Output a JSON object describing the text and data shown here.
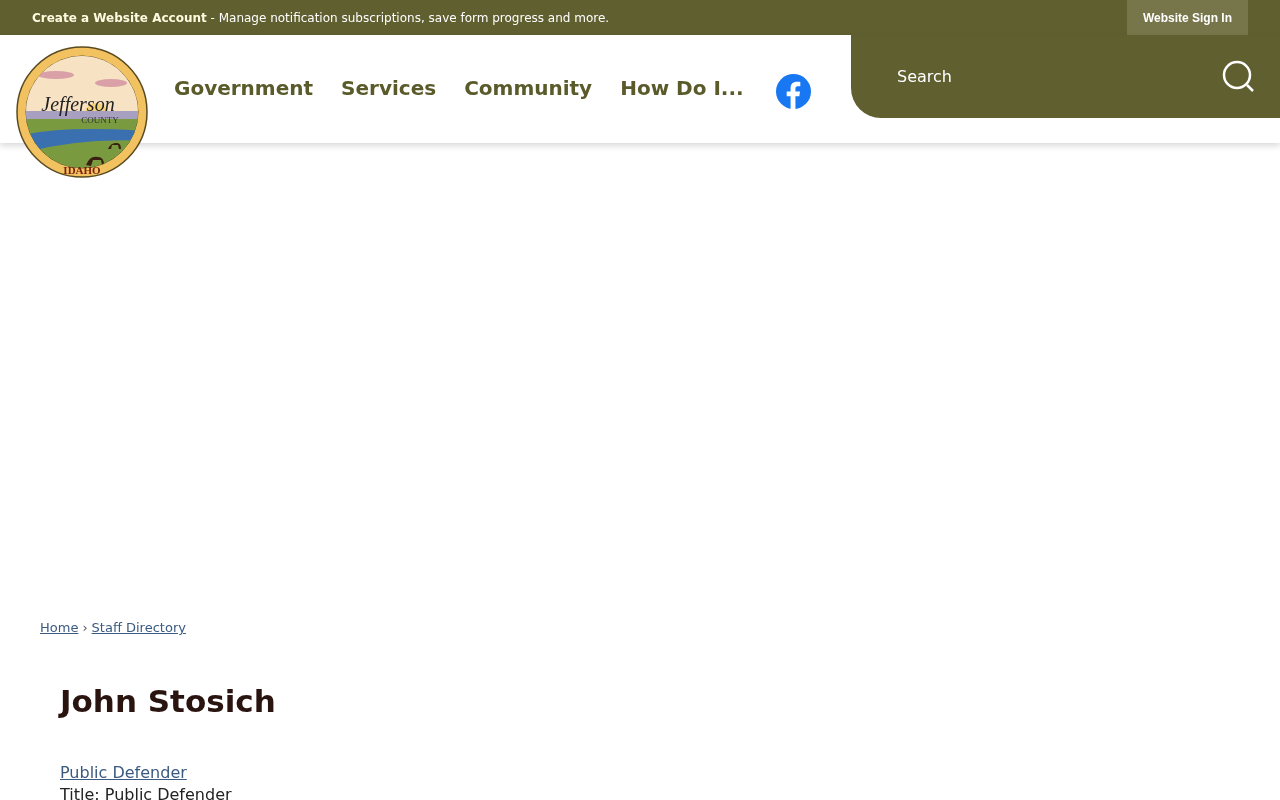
{
  "top_bar": {
    "account_link": "Create a Website Account",
    "account_text": " - Manage notification subscriptions, save form progress and more.",
    "sign_in": "Website Sign In"
  },
  "logo": {
    "name": "Jefferson",
    "county": "COUNTY",
    "state": "IDAHO"
  },
  "nav": [
    "Government",
    "Services",
    "Community",
    "How Do I..."
  ],
  "search": {
    "placeholder": "Search"
  },
  "breadcrumb": [
    "Home",
    "Staff Directory"
  ],
  "breadcrumb_separator": "›",
  "person": {
    "name": "John Stosich",
    "department": "Public Defender",
    "title": "Title: Public Defender"
  }
}
